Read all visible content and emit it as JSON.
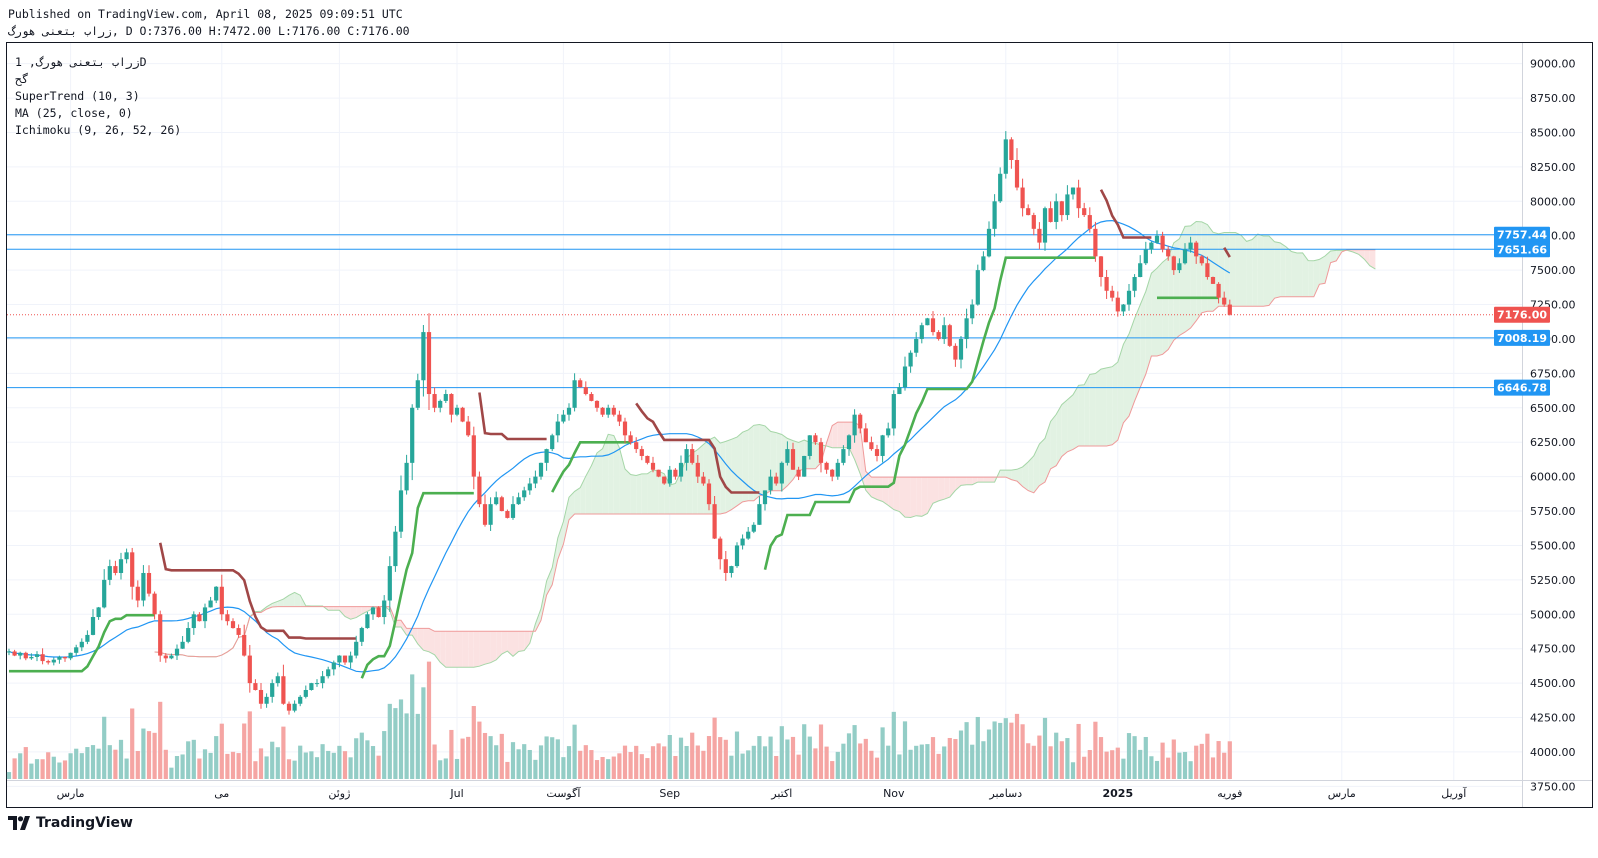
{
  "header": {
    "published": "Published on TradingView.com, April 08, 2025 09:09:51 UTC",
    "ohlc_line": "زراب  بتعنی هورگ, D O:7376.00 H:7472.00 L:7176.00 C:7176.00"
  },
  "legend": {
    "symbol_line": "زراب بتعنی هورگ, 1D",
    "exchange": "گح",
    "indicators": [
      "SuperTrend (10, 3)",
      "MA (25, close, 0)",
      "Ichimoku (9, 26, 52, 26)"
    ]
  },
  "brand": {
    "name": "TradingView"
  },
  "colors": {
    "up": "#26a69a",
    "down": "#ef5350",
    "up_volume": "#93cdc6",
    "down_volume": "#f5a5a3",
    "supertrend_up": "#4caf50",
    "supertrend_down": "#a04747",
    "ma": "#2196f3",
    "cloud_up": "#e2f2e3",
    "cloud_down": "#fbe2e2",
    "cloud_edge_up": "#a5d6a7",
    "cloud_edge_down": "#ef9a9a",
    "hline": "#2196f3",
    "current_price": "#ef5350"
  },
  "chart_data": {
    "type": "candlestick",
    "ylim": [
      3600,
      9150
    ],
    "y_ticks": [
      3750,
      4000,
      4250,
      4500,
      4750,
      5000,
      5250,
      5500,
      5750,
      6000,
      6250,
      6500,
      6750,
      7000,
      7250,
      7500,
      7750,
      8000,
      8250,
      8500,
      8750,
      9000
    ],
    "y_tick_labels": [
      "3750.00",
      "4000.00",
      "4250.00",
      "4500.00",
      "4750.00",
      "5000.00",
      "5250.00",
      "5500.00",
      "5750.00",
      "6000.00",
      "6250.00",
      "6500.00",
      "6750.00",
      "7000.00",
      "7250.00",
      "7500.00",
      "7750.00",
      "8000.00",
      "8250.00",
      "8500.00",
      "8750.00",
      "9000.00"
    ],
    "x_labels": [
      "مارس",
      "می",
      "ژوئن",
      "Jul",
      "آگوست",
      "Sep",
      "اکتبر",
      "Nov",
      "دسامبر",
      "2025",
      "فوریه",
      "مارس",
      "آوریل"
    ],
    "x_label_bar_index": [
      11,
      38,
      59,
      80,
      99,
      118,
      138,
      158,
      178,
      198,
      218,
      238,
      258
    ],
    "horizontal_levels": [
      {
        "value": 7757.44,
        "label": "7757.44"
      },
      {
        "value": 7651.66,
        "label": "7651.66"
      },
      {
        "value": 7008.19,
        "label": "7008.19"
      },
      {
        "value": 6646.78,
        "label": "6646.78"
      }
    ],
    "current_price": {
      "value": 7176.0,
      "label": "7176.00"
    },
    "close_series": [
      4730,
      4700,
      4720,
      4680,
      4690,
      4710,
      4660,
      4650,
      4670,
      4690,
      4680,
      4720,
      4760,
      4800,
      4850,
      4980,
      5050,
      5250,
      5350,
      5300,
      5400,
      5450,
      5200,
      5100,
      5300,
      5150,
      5000,
      4700,
      4680,
      4700,
      4750,
      4800,
      4900,
      5000,
      4950,
      5050,
      5100,
      5200,
      5000,
      4950,
      4900,
      4850,
      4700,
      4500,
      4450,
      4350,
      4400,
      4500,
      4550,
      4350,
      4300,
      4350,
      4400,
      4450,
      4500,
      4500,
      4550,
      4600,
      4650,
      4700,
      4650,
      4700,
      4800,
      4900,
      5000,
      5050,
      4980,
      5100,
      5350,
      5600,
      5900,
      6100,
      6500,
      6700,
      7050,
      6600,
      6500,
      6550,
      6600,
      6450,
      6500,
      6400,
      6300,
      6000,
      5800,
      5650,
      5800,
      5850,
      5750,
      5700,
      5800,
      5850,
      5900,
      5950,
      6000,
      6100,
      6200,
      6300,
      6400,
      6450,
      6500,
      6700,
      6650,
      6600,
      6550,
      6500,
      6450,
      6500,
      6450,
      6400,
      6300,
      6250,
      6200,
      6150,
      6100,
      6050,
      6000,
      5950,
      6050,
      6000,
      6100,
      6200,
      6100,
      6000,
      5950,
      5800,
      5550,
      5400,
      5300,
      5350,
      5500,
      5550,
      5600,
      5650,
      5800,
      5900,
      6000,
      5950,
      6100,
      6200,
      6050,
      6000,
      6150,
      6300,
      6250,
      6100,
      6050,
      6000,
      6100,
      6200,
      6300,
      6450,
      6350,
      6250,
      6200,
      6150,
      6300,
      6350,
      6600,
      6650,
      6800,
      6900,
      7000,
      7100,
      7150,
      7050,
      7000,
      7100,
      6950,
      6850,
      7000,
      7150,
      7250,
      7500,
      7600,
      7800,
      8000,
      8200,
      8450,
      8300,
      8100,
      7950,
      7900,
      7800,
      7700,
      7950,
      7850,
      8000,
      7900,
      8050,
      8100,
      7950,
      7900,
      7800,
      7600,
      7450,
      7350,
      7300,
      7200,
      7250,
      7350,
      7450,
      7550,
      7650,
      7700,
      7750,
      7650,
      7600,
      7500,
      7550,
      7650,
      7700,
      7600,
      7550,
      7450,
      7400,
      7300,
      7250,
      7176
    ]
  }
}
